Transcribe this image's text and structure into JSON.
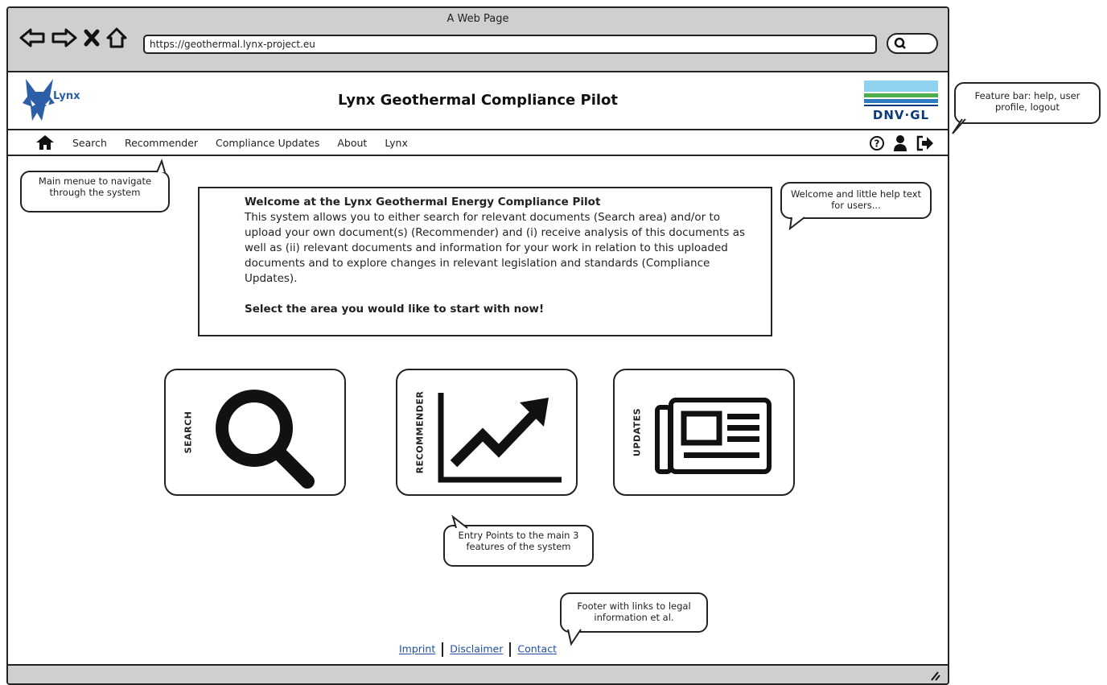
{
  "browser": {
    "window_title": "A Web Page",
    "url": "https://geothermal.lynx-project.eu"
  },
  "header": {
    "logo_text": "Lynx",
    "title": "Lynx Geothermal Compliance Pilot",
    "partner_logo_text": "DNV·GL"
  },
  "menu": {
    "items": [
      "Search",
      "Recommender",
      "Compliance Updates",
      "About",
      "Lynx"
    ]
  },
  "welcome": {
    "heading": "Welcome at the Lynx Geothermal Energy Compliance Pilot",
    "body": "This system allows you to either search for relevant documents (Search area) and/or to upload your own document(s) (Recommender) and (i) receive analysis of this documents as well as (ii) relevant documents and information for your work in relation to this uploaded documents and to explore changes in relevant legislation and standards (Compliance Updates).",
    "cta": "Select the area you would like to start with now!"
  },
  "tiles": {
    "search": "SEARCH",
    "recommender": "RECOMMENDER",
    "updates": "UPDATES"
  },
  "callouts": {
    "menu": "Main menue to navigate through the system",
    "feature_bar": "Feature bar: help, user profile, logout",
    "welcome": "Welcome and little help text for users...",
    "entry_points": "Entry Points to the main 3 features of the system",
    "footer": "Footer with links to legal information et al."
  },
  "footer": {
    "links": [
      "Imprint",
      "Disclaimer",
      "Contact"
    ]
  },
  "colors": {
    "chrome_bg": "#cfcfcf",
    "link": "#1f4fa0",
    "logo_blue": "#2c5fa8",
    "dnv_blue": "#0a3a7a"
  }
}
